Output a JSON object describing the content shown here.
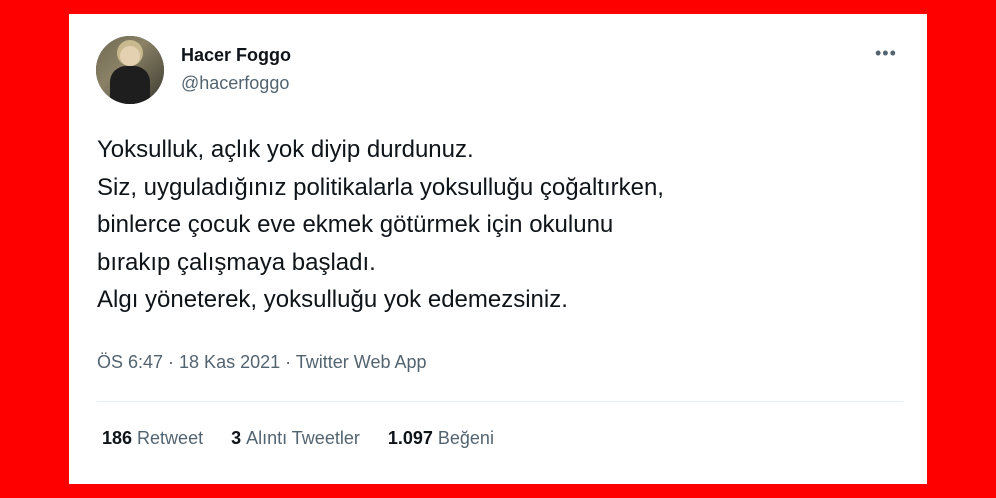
{
  "tweet": {
    "author_name": "Hacer Foggo",
    "author_handle": "@hacerfoggo",
    "more_label": "•••",
    "lines": [
      "Yoksulluk, açlık yok diyip durdunuz.",
      "Siz, uyguladığınız politikalarla yoksulluğu çoğaltırken,",
      "binlerce çocuk eve ekmek götürmek için okulunu",
      "bırakıp çalışmaya başladı.",
      "Algı yöneterek, yoksulluğu yok edemezsiniz."
    ],
    "meta": "ÖS 6:47 · 18 Kas 2021 · Twitter Web App",
    "stats": {
      "retweets_count": "186",
      "retweets_label": "Retweet",
      "quotes_count": "3",
      "quotes_label": "Alıntı Tweetler",
      "likes_count": "1.097",
      "likes_label": "Beğeni"
    }
  },
  "colors": {
    "background_frame": "#ff0000",
    "card": "#ffffff",
    "primary_text": "#0f1419",
    "secondary_text": "#536471"
  }
}
